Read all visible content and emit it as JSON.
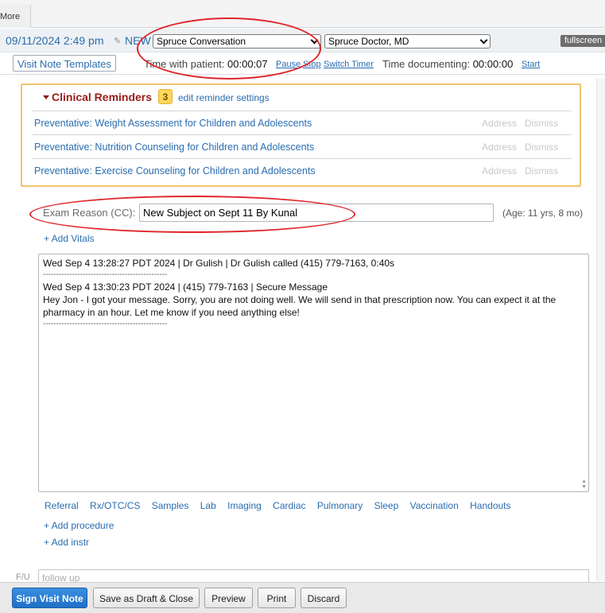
{
  "topbar": {
    "more_label": "More"
  },
  "visit": {
    "datetime": "09/11/2024 2:49 pm",
    "status": "NEW",
    "conversation_select": "Spruce Conversation",
    "provider_select": "Spruce Doctor, MD",
    "fullscreen_label": "fullscreen"
  },
  "timer": {
    "templates_label": "Visit Note Templates",
    "with_patient_label": "Time with patient:",
    "with_patient_value": "00:00:07",
    "pause": "Pause",
    "stop": "Stop",
    "switch": "Switch Timer",
    "documenting_label": "Time documenting:",
    "documenting_value": "00:00:00",
    "start": "Start"
  },
  "reminders": {
    "title": "Clinical Reminders",
    "count": "3",
    "settings_label": "edit reminder settings",
    "address_label": "Address",
    "dismiss_label": "Dismiss",
    "items": [
      {
        "label": "Preventative: Weight Assessment for Children and Adolescents"
      },
      {
        "label": "Preventative: Nutrition Counseling for Children and Adolescents"
      },
      {
        "label": "Preventative: Exercise Counseling for Children and Adolescents"
      }
    ]
  },
  "exam": {
    "label": "Exam Reason (CC):",
    "value": "New Subject on Sept 11 By Kunal",
    "age": "(Age: 11 yrs, 8 mo)",
    "add_vitals": "+ Add Vitals"
  },
  "notes": {
    "line1": "Wed Sep 4 13:28:27 PDT 2024 | Dr Gulish | Dr Gulish called (415) 779-7163, 0:40s",
    "separator": "-----------------------------------------------",
    "line2": "Wed Sep 4 13:30:23 PDT 2024 | (415) 779-7163 | Secure Message",
    "message": "Hey Jon - I got your message. Sorry, you are not doing well. We will send in that prescription now. You can expect it at the pharmacy in an hour. Let me know if you need anything else!"
  },
  "orders": {
    "links": [
      "Referral",
      "Rx/OTC/CS",
      "Samples",
      "Lab",
      "Imaging",
      "Cardiac",
      "Pulmonary",
      "Sleep",
      "Vaccination",
      "Handouts"
    ],
    "add_procedure": "+ Add procedure",
    "add_instr": "+ Add instr"
  },
  "followup": {
    "label": "F/U",
    "placeholder": "follow up"
  },
  "actions": {
    "sign": "Sign Visit Note",
    "draft": "Save as Draft & Close",
    "preview": "Preview",
    "print": "Print",
    "discard": "Discard"
  }
}
